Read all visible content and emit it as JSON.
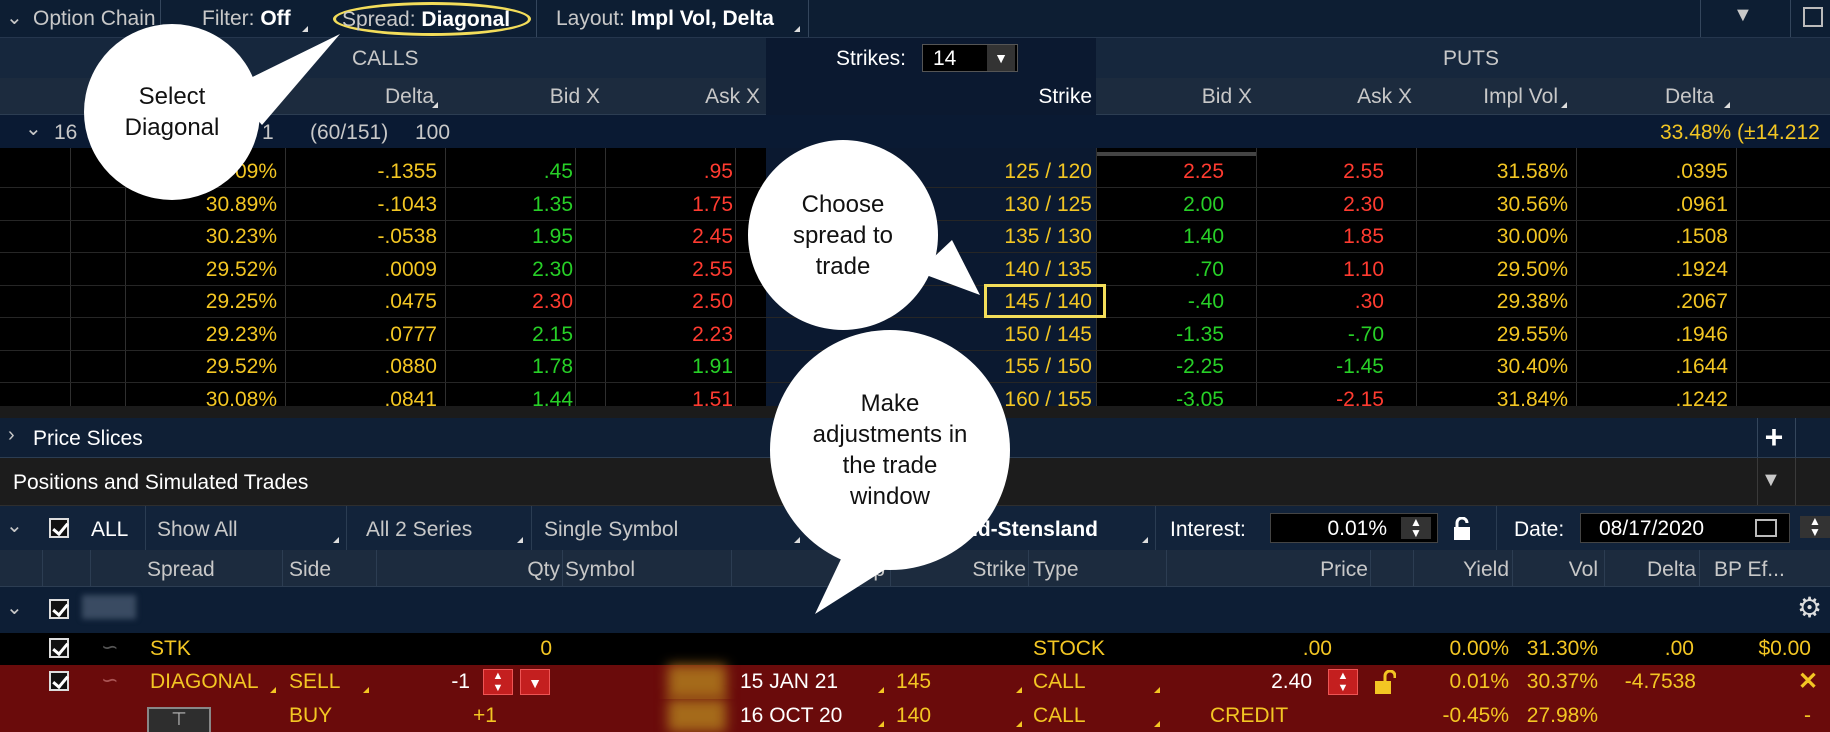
{
  "toolbar": {
    "title": "Option Chain",
    "filter_label": "Filter:",
    "filter_value": "Off",
    "spread_label": "Spread:",
    "spread_value": "Diagonal",
    "layout_label": "Layout:",
    "layout_value": "Impl Vol, Delta"
  },
  "chain": {
    "calls_title": "CALLS",
    "puts_title": "PUTS",
    "strikes_label": "Strikes:",
    "strikes_value": "14",
    "call_headers": [
      "Delta",
      "Bid X",
      "Ask X"
    ],
    "strike_header": "Strike",
    "put_headers": [
      "Bid X",
      "Ask X",
      "Impl Vol",
      "Delta"
    ],
    "series": {
      "label": "16",
      "partial": "1",
      "days": "(60/151)",
      "multiplier": "100",
      "iv": "33.48% (±14.212"
    },
    "rows": [
      {
        "call_iv": "09%",
        "call_delta": "-.1355",
        "call_bid": ".45",
        "call_ask": ".95",
        "strike": "125 / 120",
        "put_bid": "2.25",
        "put_ask": "2.55",
        "put_iv": "31.58%",
        "put_delta": ".0395",
        "call_bid_color": "grn",
        "call_ask_color": "red",
        "put_bid_color": "red",
        "put_ask_color": "red"
      },
      {
        "call_iv": "30.89%",
        "call_delta": "-.1043",
        "call_bid": "1.35",
        "call_ask": "1.75",
        "strike": "130 / 125",
        "put_bid": "2.00",
        "put_ask": "2.30",
        "put_iv": "30.56%",
        "put_delta": ".0961",
        "call_bid_color": "grn",
        "call_ask_color": "red",
        "put_bid_color": "grn",
        "put_ask_color": "red"
      },
      {
        "call_iv": "30.23%",
        "call_delta": "-.0538",
        "call_bid": "1.95",
        "call_ask": "2.45",
        "strike": "135 / 130",
        "put_bid": "1.40",
        "put_ask": "1.85",
        "put_iv": "30.00%",
        "put_delta": ".1508",
        "call_bid_color": "grn",
        "call_ask_color": "red",
        "put_bid_color": "grn",
        "put_ask_color": "red"
      },
      {
        "call_iv": "29.52%",
        "call_delta": ".0009",
        "call_bid": "2.30",
        "call_ask": "2.55",
        "strike": "140 / 135",
        "put_bid": ".70",
        "put_ask": "1.10",
        "put_iv": "29.50%",
        "put_delta": ".1924",
        "call_bid_color": "grn",
        "call_ask_color": "red",
        "put_bid_color": "grn",
        "put_ask_color": "red"
      },
      {
        "call_iv": "29.25%",
        "call_delta": ".0475",
        "call_bid": "2.30",
        "call_ask": "2.50",
        "strike": "145 / 140",
        "put_bid": "-.40",
        "put_ask": ".30",
        "put_iv": "29.38%",
        "put_delta": ".2067",
        "call_bid_color": "red",
        "call_ask_color": "red",
        "put_bid_color": "grn",
        "put_ask_color": "red"
      },
      {
        "call_iv": "29.23%",
        "call_delta": ".0777",
        "call_bid": "2.15",
        "call_ask": "2.23",
        "strike": "150 / 145",
        "put_bid": "-1.35",
        "put_ask": "-.70",
        "put_iv": "29.55%",
        "put_delta": ".1946",
        "call_bid_color": "grn",
        "call_ask_color": "red",
        "put_bid_color": "grn",
        "put_ask_color": "grn"
      },
      {
        "call_iv": "29.52%",
        "call_delta": ".0880",
        "call_bid": "1.78",
        "call_ask": "1.91",
        "strike": "155 / 150",
        "put_bid": "-2.25",
        "put_ask": "-1.45",
        "put_iv": "30.40%",
        "put_delta": ".1644",
        "call_bid_color": "grn",
        "call_ask_color": "grn",
        "put_bid_color": "grn",
        "put_ask_color": "grn"
      },
      {
        "call_iv": "30.08%",
        "call_delta": ".0841",
        "call_bid": "1.44",
        "call_ask": "1.51",
        "strike": "160 / 155",
        "put_bid": "-3.05",
        "put_ask": "-2.15",
        "put_iv": "31.84%",
        "put_delta": ".1242",
        "call_bid_color": "grn",
        "call_ask_color": "red",
        "put_bid_color": "grn",
        "put_ask_color": "red"
      }
    ]
  },
  "price_slices": {
    "label": "Price Slices"
  },
  "positions": {
    "title": "Positions and Simulated Trades",
    "all_label": "ALL",
    "show_all": "Show All",
    "series": "All 2 Series",
    "symbol_mode": "Single Symbol",
    "model": "nd-Stensland",
    "interest_label": "Interest:",
    "interest_value": "0.01%",
    "date_label": "Date:",
    "date_value": "08/17/2020",
    "headers": {
      "spread": "Spread",
      "side": "Side",
      "qty": "Qty",
      "symbol": "Symbol",
      "exp": "Exp",
      "strike": "Strike",
      "type": "Type",
      "price": "Price",
      "yield": "Yield",
      "vol": "Vol",
      "delta": "Delta",
      "bp": "BP Ef..."
    },
    "stk_row": {
      "spread": "STK",
      "qty": "0",
      "type": "STOCK",
      "price": ".00",
      "yield": "0.00%",
      "vol": "31.30%",
      "delta": ".00",
      "bp": "$0.00"
    },
    "leg1": {
      "spread": "DIAGONAL",
      "side": "SELL",
      "qty": "-1",
      "exp": "15 JAN 21",
      "strike": "145",
      "type": "CALL",
      "price": "2.40",
      "yield": "0.01%",
      "vol": "30.37%",
      "delta": "-4.7538",
      "bp": "-"
    },
    "leg2": {
      "side": "BUY",
      "qty": "+1",
      "exp": "16 OCT 20",
      "strike": "140",
      "type": "CALL",
      "price": "CREDIT",
      "yield": "-0.45%",
      "vol": "27.98%",
      "bp": "-"
    }
  },
  "callouts": {
    "select": "Select Diagonal",
    "choose": "Choose spread to trade",
    "adjust": "Make adjustments in the trade window"
  }
}
